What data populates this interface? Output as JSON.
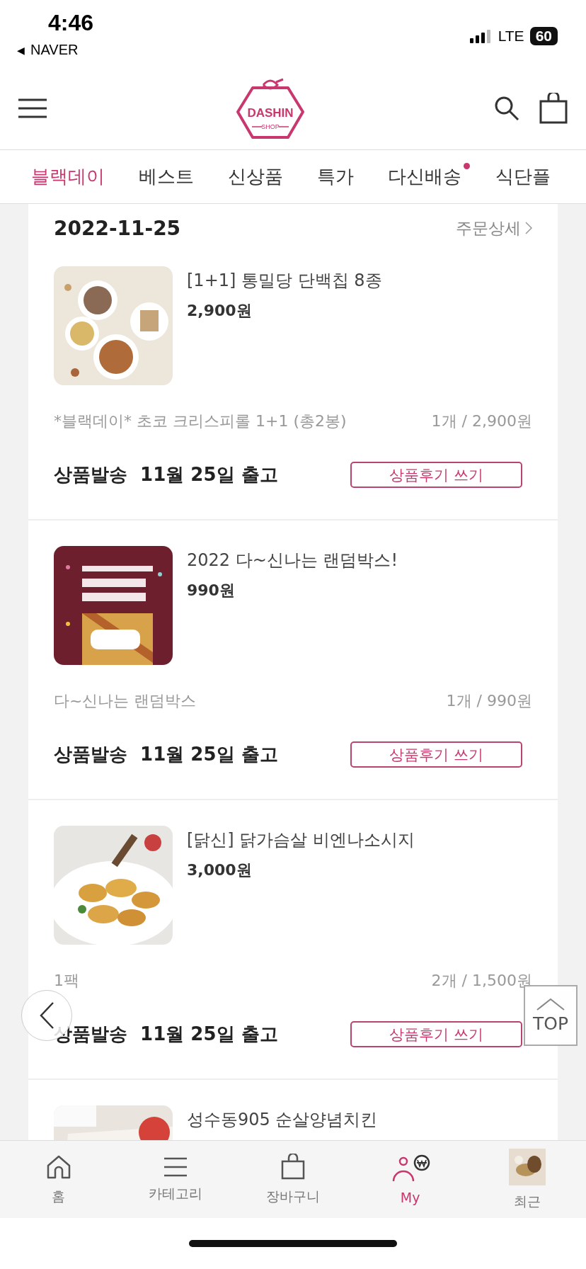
{
  "status_bar": {
    "time": "4:46",
    "back_arrow": "◀",
    "back_app": "NAVER",
    "network": "LTE",
    "battery": "60"
  },
  "header": {
    "logo": {
      "text": "DASHIN",
      "subtext": "SHOP"
    }
  },
  "tabs": [
    {
      "label": "블랙데이",
      "selected": true,
      "dot": false
    },
    {
      "label": "베스트",
      "selected": false,
      "dot": false
    },
    {
      "label": "신상품",
      "selected": false,
      "dot": false
    },
    {
      "label": "특가",
      "selected": false,
      "dot": false
    },
    {
      "label": "다신배송",
      "selected": false,
      "dot": true
    },
    {
      "label": "식단플",
      "selected": false,
      "dot": false
    }
  ],
  "order": {
    "date": "2022-11-25",
    "detail_link": "주문상세",
    "items": [
      {
        "name": "[1+1] 통밀당 단백칩 8종",
        "price": "2,900원",
        "option": "*블랙데이* 초코 크리스피롤 1+1 (총2봉)",
        "quantity": "1개 / 2,900원",
        "ship_label": "상품발송",
        "ship_date": "11월 25일 출고",
        "review_button": "상품후기 쓰기"
      },
      {
        "name": "2022 다~신나는 랜덤박스!",
        "price": "990원",
        "option": "다~신나는 랜덤박스",
        "quantity": "1개 / 990원",
        "ship_label": "상품발송",
        "ship_date": "11월 25일 출고",
        "review_button": "상품후기 쓰기"
      },
      {
        "name": "[닭신] 닭가슴살 비엔나소시지",
        "price": "3,000원",
        "option": "1팩",
        "quantity": "2개 / 1,500원",
        "ship_label": "상품발송",
        "ship_date": "11월 25일 출고",
        "review_button": "상품후기 쓰기"
      },
      {
        "name": "성수동905 순살양념치킨"
      }
    ]
  },
  "top_button": "TOP",
  "bottom_nav": [
    {
      "kind": "home",
      "label": "홈",
      "selected": false
    },
    {
      "kind": "menu",
      "label": "카테고리",
      "selected": false
    },
    {
      "kind": "bag",
      "label": "장바구니",
      "selected": false
    },
    {
      "kind": "my",
      "label": "My",
      "selected": true
    },
    {
      "kind": "thumbnail",
      "label": "최근",
      "selected": false
    }
  ]
}
